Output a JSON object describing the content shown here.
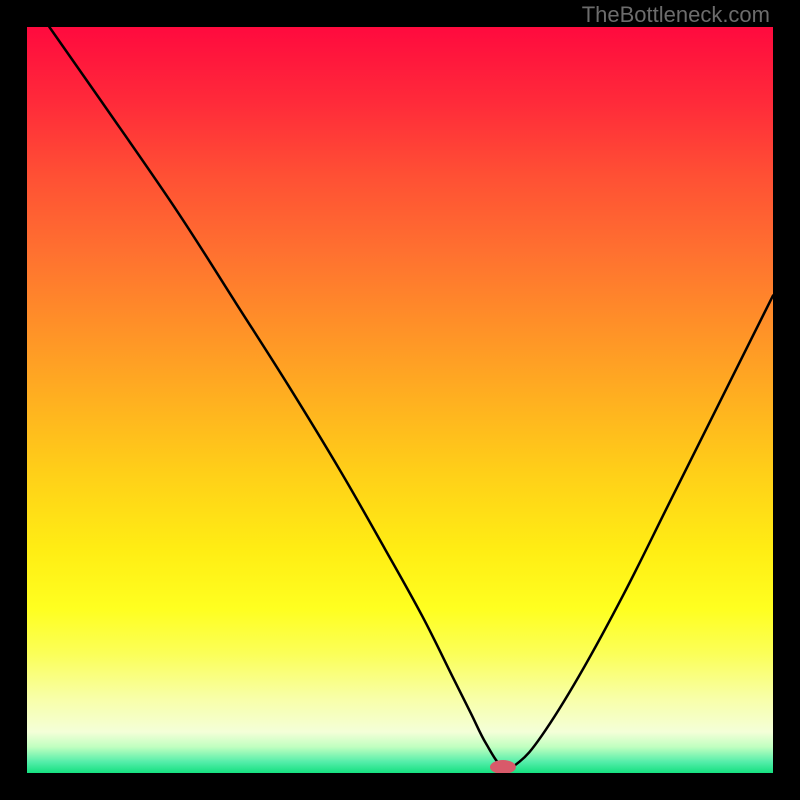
{
  "watermark": "TheBottleneck.com",
  "gradient": {
    "stops": [
      {
        "offset": 0.0,
        "color": "#ff0a3e"
      },
      {
        "offset": 0.1,
        "color": "#ff2a3a"
      },
      {
        "offset": 0.2,
        "color": "#ff5034"
      },
      {
        "offset": 0.3,
        "color": "#ff7030"
      },
      {
        "offset": 0.4,
        "color": "#ff9028"
      },
      {
        "offset": 0.5,
        "color": "#ffb020"
      },
      {
        "offset": 0.6,
        "color": "#ffd018"
      },
      {
        "offset": 0.7,
        "color": "#ffed14"
      },
      {
        "offset": 0.78,
        "color": "#ffff20"
      },
      {
        "offset": 0.84,
        "color": "#fbff58"
      },
      {
        "offset": 0.9,
        "color": "#f8ffa8"
      },
      {
        "offset": 0.945,
        "color": "#f4ffd8"
      },
      {
        "offset": 0.965,
        "color": "#c0ffc0"
      },
      {
        "offset": 0.985,
        "color": "#55eeaa"
      },
      {
        "offset": 1.0,
        "color": "#15e080"
      }
    ]
  },
  "marker": {
    "x_pct": 0.638,
    "y_pct": 0.992,
    "rx": 13,
    "ry": 7,
    "fill": "#d85a6a"
  },
  "chart_data": {
    "type": "line",
    "title": "",
    "xlabel": "",
    "ylabel": "",
    "xlim": [
      0,
      100
    ],
    "ylim": [
      0,
      100
    ],
    "grid": false,
    "series": [
      {
        "name": "bottleneck-curve",
        "x": [
          3,
          10,
          20,
          28,
          35,
          42,
          48,
          53,
          57,
          59.5,
          61.5,
          63.8,
          66,
          69,
          74,
          80,
          86,
          92,
          97,
          100
        ],
        "y": [
          100,
          90,
          75.5,
          63,
          52,
          40.5,
          30,
          21,
          13,
          8,
          4,
          0.8,
          1.5,
          5,
          13,
          24,
          36,
          48,
          58,
          64
        ]
      }
    ],
    "annotations": [
      {
        "type": "marker",
        "x": 63.8,
        "y": 0.8,
        "label": "optimal-point"
      }
    ]
  }
}
